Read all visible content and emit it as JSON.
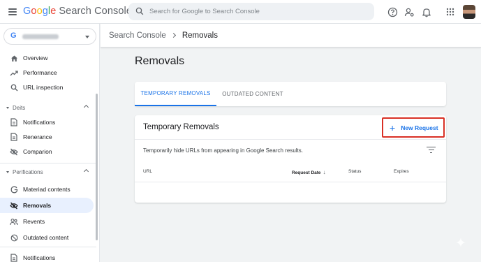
{
  "app": {
    "google_letters": [
      "G",
      "o",
      "o",
      "g",
      "l",
      "e"
    ],
    "product_name": "Search Console"
  },
  "search": {
    "placeholder": "Search for Google to Search Console"
  },
  "sidebar": {
    "items_top": [
      {
        "label": "Overview",
        "icon": "home-icon"
      },
      {
        "label": "Performance",
        "icon": "trending-up-icon"
      },
      {
        "label": "URL inspection",
        "icon": "search-icon"
      }
    ],
    "section_1": {
      "label": "Deits",
      "items": [
        {
          "label": "Notifications",
          "icon": "document-icon"
        },
        {
          "label": "Renerance",
          "icon": "document-icon"
        },
        {
          "label": "Comparion",
          "icon": "eye-off-icon"
        }
      ]
    },
    "section_2": {
      "label": "Perifications",
      "items": [
        {
          "label": "Materiad contents",
          "icon": "g-logo-icon"
        },
        {
          "label": "Removals",
          "icon": "eye-off-icon",
          "active": true
        },
        {
          "label": "Revents",
          "icon": "people-icon"
        },
        {
          "label": "Outdated content",
          "icon": "blocked-icon"
        },
        {
          "label": "Notifications",
          "icon": "document-icon"
        }
      ]
    }
  },
  "breadcrumb": {
    "root": "Search Console",
    "current": "Removals"
  },
  "main": {
    "title": "Removals",
    "tabs": [
      {
        "label": "TEMPORARY REMOVALS",
        "active": true
      },
      {
        "label": "OUTDATED CONTENT",
        "active": false
      }
    ],
    "card": {
      "title": "Temporary Removals",
      "new_request_label": "New Request",
      "description": "Temporarily hide URLs from appearing in Google Search results.",
      "columns": [
        "URL",
        "Request Date",
        "Status",
        "Expires"
      ],
      "sort_indicator": "↓"
    }
  },
  "colors": {
    "accent": "#1a73e8",
    "highlight_box": "#d93025",
    "active_nav_bg": "#e8f0fe"
  }
}
